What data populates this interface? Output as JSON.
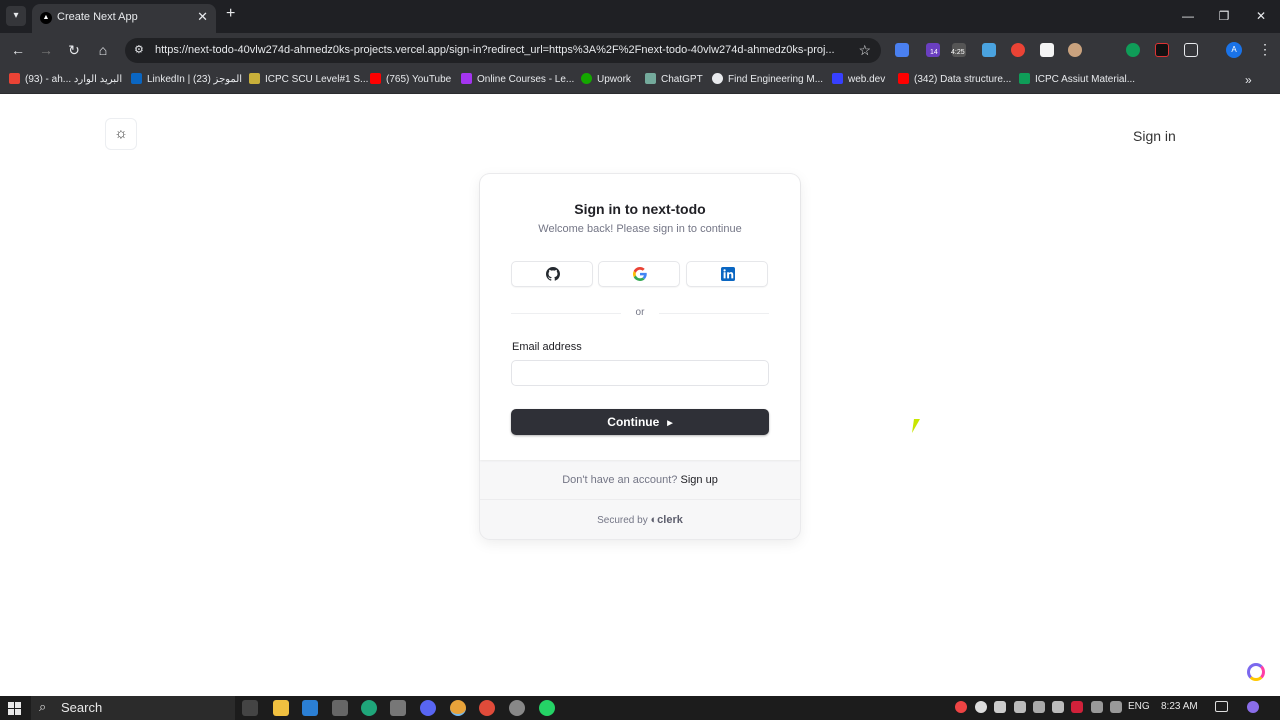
{
  "browser": {
    "tab_title": "Create Next App",
    "url": "https://next-todo-40vlw274d-ahmedz0ks-projects.vercel.app/sign-in?redirect_url=https%3A%2F%2Fnext-todo-40vlw274d-ahmedz0ks-proj...",
    "extension_badge_1": "14",
    "extension_badge_2": "4:25",
    "profile_initial": "A",
    "bookmarks": [
      {
        "label": "(93) - ah... البريد الوارد",
        "color": "#ea4335"
      },
      {
        "label": "LinkedIn | الموجز (23)",
        "color": "#0a66c2"
      },
      {
        "label": "ICPC SCU Level#1 S...",
        "color": "#c9b03a"
      },
      {
        "label": "(765) YouTube",
        "color": "#ff0000"
      },
      {
        "label": "Online Courses - Le...",
        "color": "#a435f0"
      },
      {
        "label": "Upwork",
        "color": "#14a800"
      },
      {
        "label": "ChatGPT",
        "color": "#74aa9c"
      },
      {
        "label": "Find Engineering M...",
        "color": "#e8eaed"
      },
      {
        "label": "web.dev",
        "color": "#3740ff"
      },
      {
        "label": "(342) Data structure...",
        "color": "#ff0000"
      },
      {
        "label": "ICPC Assiut Material...",
        "color": "#0f9d58"
      }
    ]
  },
  "header": {
    "signin_link": "Sign in"
  },
  "card": {
    "title": "Sign in to next-todo",
    "subtitle": "Welcome back! Please sign in to continue",
    "divider": "or",
    "email_label": "Email address",
    "email_value": "",
    "continue_label": "Continue",
    "footer_prompt": "Don't have an account?",
    "footer_signup": "Sign up",
    "secured_by": "Secured by",
    "brand": "clerk"
  },
  "taskbar": {
    "search_label": "Search",
    "language": "ENG",
    "time": "8:23 AM"
  }
}
